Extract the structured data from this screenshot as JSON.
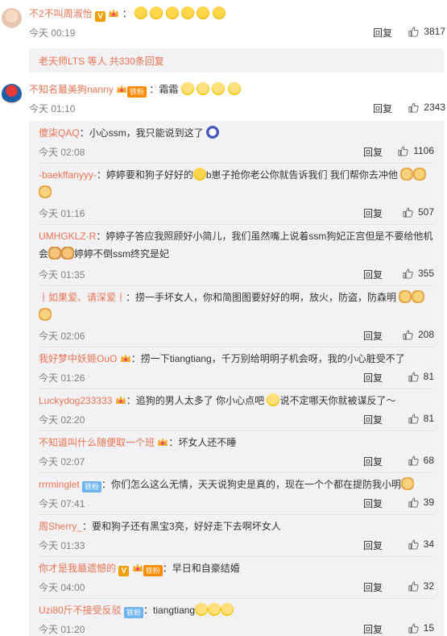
{
  "top_comments": [
    {
      "username": "不2不叫周淑怡",
      "text": "：",
      "time": "今天 00:19",
      "reply_label": "回复",
      "likes": "3817"
    },
    {
      "username": "不知名最美狗nanny",
      "fan_badge": "铁粉",
      "text": "：霜霜",
      "time": "今天 01:10",
      "reply_label": "回复",
      "likes": "2343"
    }
  ],
  "more_replies": "老天师LTS 等人 共330条回复",
  "replies": [
    {
      "username": "傻柒QAQ",
      "text": "：小心ssm，我只能说到这了",
      "time": "今天 02:08",
      "reply_label": "回复",
      "likes": "1106"
    },
    {
      "username": "-baekffanyyy-",
      "text_a": "：婷婷要和狗子好好的",
      "text_b": "b崽子抢你老公你就告诉我们 我们帮你去冲他",
      "time": "今天 01:16",
      "reply_label": "回复",
      "likes": "507"
    },
    {
      "username": "UMHGKLZ·R",
      "text_a": "：婷婷子答应我照顾好小简儿，我们虽然嘴上说着ssm狗妃正宫但是不要给他机",
      "text_b": "会",
      "text_c": "婷婷不倒ssm终究是妃",
      "time": "今天 01:35",
      "reply_label": "回复",
      "likes": "355"
    },
    {
      "username": "丨如果爱、请深爱丨",
      "text": "：捞一手坏女人，你和简图图要好好的啊，放火，防盗，防森明",
      "time": "今天 02:06",
      "reply_label": "回复",
      "likes": "208"
    },
    {
      "username": "我好梦中妖姬OuO",
      "text": "：捞一下tiangtiang，千万别给明明子机会呀，我的小心脏受不了",
      "time": "今天 01:26",
      "reply_label": "回复",
      "likes": "81"
    },
    {
      "username": "Luckydog233333",
      "text_a": "：追狗的男人太多了 你小心点吧",
      "text_b": "说不定哪天你就被谋反了～",
      "time": "今天 02:20",
      "reply_label": "回复",
      "likes": "81"
    },
    {
      "username": "不知道叫什么随便取一个班",
      "text": "：坏女人还不睡",
      "time": "今天 02:07",
      "reply_label": "回复",
      "likes": "68"
    },
    {
      "username": "rrrminglet",
      "tie_badge": "铁粉",
      "text": "：你们怎么这么无情，天天说狗史是真的，现在一个个都在提防我小明",
      "time": "今天 07:41",
      "reply_label": "回复",
      "likes": "39"
    },
    {
      "username": "周Sherry_",
      "text": "：要和狗子还有黑宝3亮，好好走下去啊坏女人",
      "time": "今天 01:33",
      "reply_label": "回复",
      "likes": "34"
    },
    {
      "username": "你才是我最遗憾的",
      "fan_badge": "铁粉",
      "text": "：早日和自豪结婚",
      "time": "今天 04:00",
      "reply_label": "回复",
      "likes": "32"
    },
    {
      "username": "Uzi80斤不接受反驳",
      "tie_badge": "铁粉",
      "text": "：tiangtiang",
      "time": "今天 01:20",
      "reply_label": "回复",
      "likes": "15"
    }
  ],
  "icons": {
    "verified": "V",
    "like": "thumb-up-icon"
  },
  "colors": {
    "username": "#eb7350",
    "meta": "#808080",
    "reply_bg": "#f2f2f5",
    "fan_badge": "#ff8a00",
    "tie_badge": "#6fb4f0"
  }
}
